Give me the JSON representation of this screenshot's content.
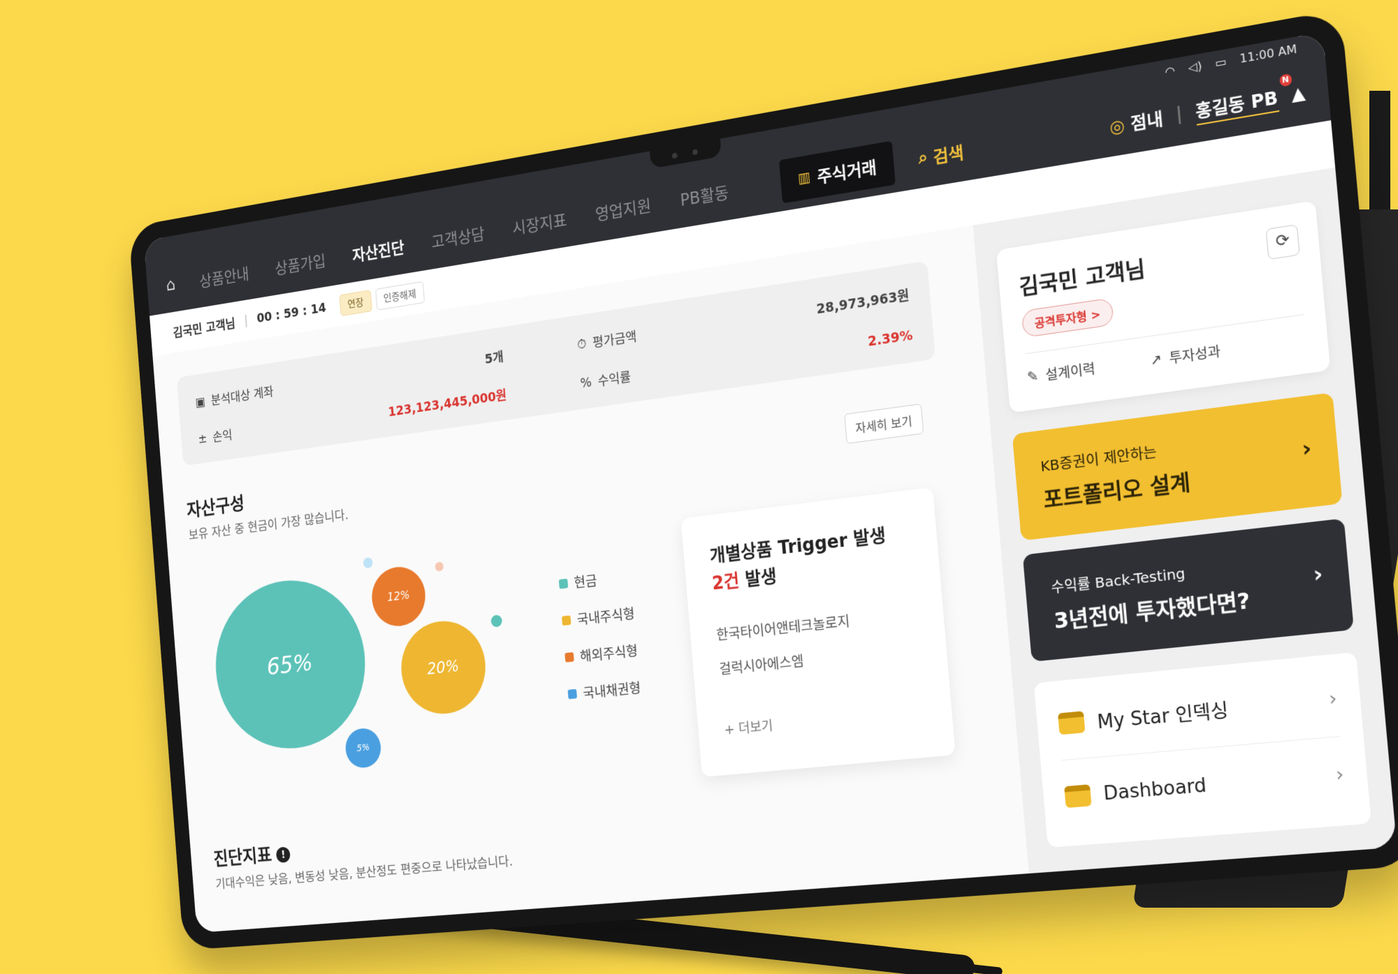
{
  "statusbar": {
    "time": "11:00 AM"
  },
  "nav": {
    "items": [
      "상품안내",
      "상품가입",
      "자산진단",
      "고객상담",
      "시장지표",
      "영업지원",
      "PB활동"
    ],
    "active_index": 2,
    "trade_label": "주식거래",
    "search_label": "검색",
    "branch_label": "점내",
    "user_label": "홍길동 PB",
    "badge": "N"
  },
  "session": {
    "customer": "김국민 고객님",
    "timer": "00 : 59 : 14",
    "extend_label": "연장",
    "release_label": "인증해제"
  },
  "summary": {
    "accounts_label": "분석대상 계좌",
    "accounts_value": "5개",
    "eval_label": "평가금액",
    "eval_value": "28,973,963원",
    "pnl_label": "손익",
    "pnl_value": "123,123,445,000원",
    "return_label": "수익률",
    "return_value": "2.39%"
  },
  "composition": {
    "title": "자산구성",
    "subtitle": "보유 자산 중 현금이 가장 많습니다.",
    "detail_label": "자세히 보기",
    "segments": [
      {
        "label": "현금",
        "percent": "65%",
        "color": "#5cc2b8"
      },
      {
        "label": "국내주식형",
        "percent": "20%",
        "color": "#eeb631"
      },
      {
        "label": "해외주식형",
        "percent": "12%",
        "color": "#e87a2d"
      },
      {
        "label": "국내채권형",
        "percent": "5%",
        "color": "#4a9fe0"
      }
    ]
  },
  "trigger": {
    "title": "개별상품 Trigger 발생",
    "count": "2건",
    "count_suffix": "발생",
    "items": [
      "한국타이어앤테크놀로지",
      "걸럭시아에스엠"
    ],
    "more_label": "+ 더보기"
  },
  "diagnosis": {
    "title": "진단지표",
    "info": "!",
    "subtitle": "기대수익은 낮음, 변동성 낮음, 분산정도 편중으로 나타났습니다."
  },
  "sidebar": {
    "customer_name": "김국민 고객님",
    "investor_type": "공격투자형 >",
    "history_label": "설계이력",
    "performance_label": "투자성과",
    "promo1_line1": "KB증권이 제안하는",
    "promo1_line2": "포트폴리오 설계",
    "promo2_line1": "수익률 Back-Testing",
    "promo2_line2": "3년전에 투자했다면?",
    "link1": "My Star 인덱싱",
    "link2": "Dashboard"
  }
}
